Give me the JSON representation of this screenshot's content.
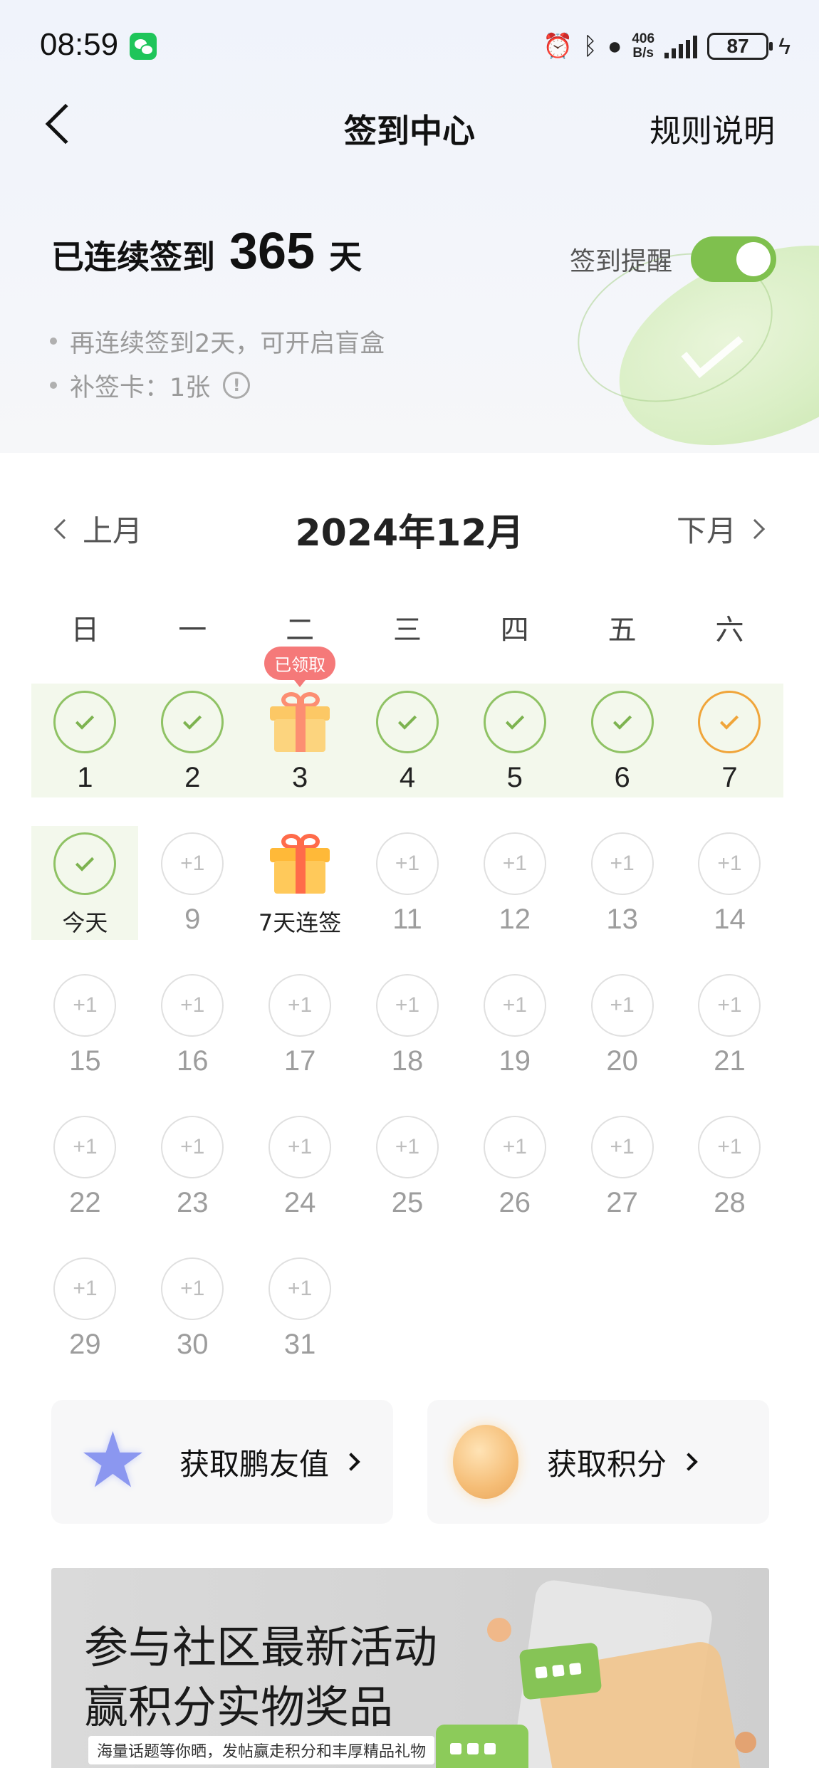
{
  "status_bar": {
    "time": "08:59",
    "net_speed_value": "406",
    "net_speed_unit": "B/s",
    "battery": "87",
    "icons": [
      "wechat-icon",
      "alarm-icon",
      "bluetooth-icon",
      "location-icon",
      "signal-icon",
      "battery-icon",
      "charging-icon"
    ]
  },
  "nav": {
    "title": "签到中心",
    "rules_label": "规则说明"
  },
  "streak": {
    "prefix": "已连续签到",
    "count": "365",
    "suffix": "天",
    "reminder_label": "签到提醒",
    "reminder_on": true
  },
  "notes": [
    "再连续签到2天，可开启盲盒",
    "补签卡：1张"
  ],
  "calendar": {
    "prev_label": "上月",
    "next_label": "下月",
    "month_title": "2024年12月",
    "weekdays": [
      "日",
      "一",
      "二",
      "三",
      "四",
      "五",
      "六"
    ],
    "claimed_badge": "已领取",
    "today_label": "今天",
    "streak_gift_label": "7天连签",
    "plus_label": "+1",
    "days": [
      {
        "num": "1",
        "state": "done"
      },
      {
        "num": "2",
        "state": "done"
      },
      {
        "num": "3",
        "state": "gift-claimed"
      },
      {
        "num": "4",
        "state": "done"
      },
      {
        "num": "5",
        "state": "done"
      },
      {
        "num": "6",
        "state": "done"
      },
      {
        "num": "7",
        "state": "pending"
      },
      {
        "num": "今天",
        "state": "today"
      },
      {
        "num": "9",
        "state": "future"
      },
      {
        "num": "7天连签",
        "state": "gift"
      },
      {
        "num": "11",
        "state": "future"
      },
      {
        "num": "12",
        "state": "future"
      },
      {
        "num": "13",
        "state": "future"
      },
      {
        "num": "14",
        "state": "future"
      },
      {
        "num": "15",
        "state": "future"
      },
      {
        "num": "16",
        "state": "future"
      },
      {
        "num": "17",
        "state": "future"
      },
      {
        "num": "18",
        "state": "future"
      },
      {
        "num": "19",
        "state": "future"
      },
      {
        "num": "20",
        "state": "future"
      },
      {
        "num": "21",
        "state": "future"
      },
      {
        "num": "22",
        "state": "future"
      },
      {
        "num": "23",
        "state": "future"
      },
      {
        "num": "24",
        "state": "future"
      },
      {
        "num": "25",
        "state": "future"
      },
      {
        "num": "26",
        "state": "future"
      },
      {
        "num": "27",
        "state": "future"
      },
      {
        "num": "28",
        "state": "future"
      },
      {
        "num": "29",
        "state": "future"
      },
      {
        "num": "30",
        "state": "future"
      },
      {
        "num": "31",
        "state": "future"
      }
    ]
  },
  "cards": [
    {
      "label": "获取鹏友值",
      "icon": "star-icon"
    },
    {
      "label": "获取积分",
      "icon": "coin-icon"
    }
  ],
  "banner": {
    "title_line1": "参与社区最新活动",
    "title_line2": "赢积分实物奖品",
    "subtitle": "海量话题等你晒，发帖赢走积分和丰厚精品礼物"
  },
  "colors": {
    "accent_green": "#7fc04e",
    "done_border": "#8fc264",
    "pending_border": "#f0a53a",
    "badge_red": "#f24d4d"
  }
}
